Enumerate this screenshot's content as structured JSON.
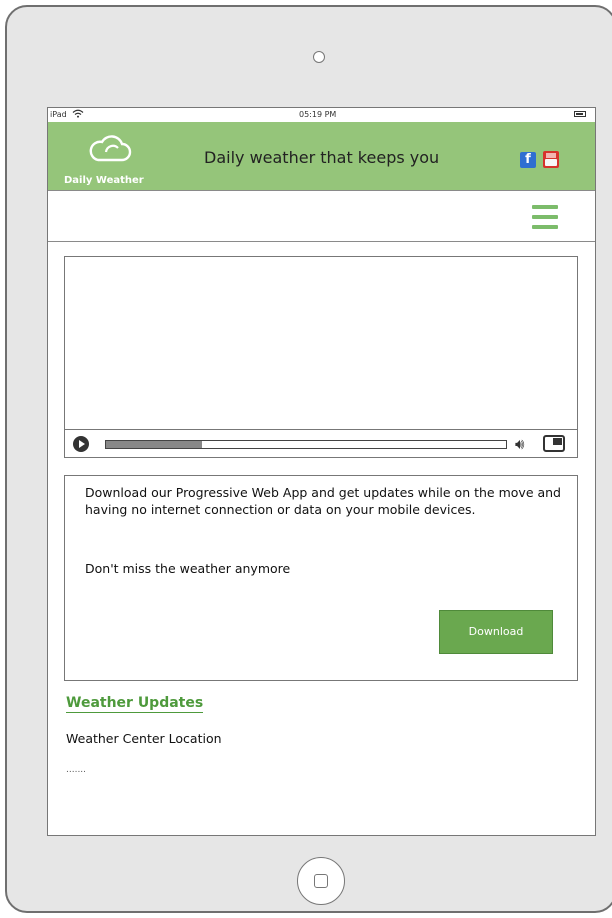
{
  "device": {
    "status": {
      "carrier": "iPad",
      "time": "05:19 PM"
    }
  },
  "header": {
    "logo_label": "Daily Weather",
    "tagline": "Daily weather that keeps you",
    "social": [
      {
        "icon": "facebook-icon"
      },
      {
        "icon": "youtube-icon"
      }
    ]
  },
  "nav": {
    "menu_icon": "hamburger-menu-icon"
  },
  "video": {
    "progress": 0.24
  },
  "promo": {
    "text": "Download our Progressive Web App and get updates while on the move and having no internet connection or data on your mobile devices.",
    "tagline": "Don't miss the weather anymore",
    "button_label": "Download"
  },
  "updates": {
    "title": "Weather Updates",
    "subheading": "Weather Center Location",
    "ellipsis": "......."
  },
  "colors": {
    "header_bg": "#95c57a",
    "accent": "#6aa84f",
    "title_green": "#4e9a3c"
  }
}
